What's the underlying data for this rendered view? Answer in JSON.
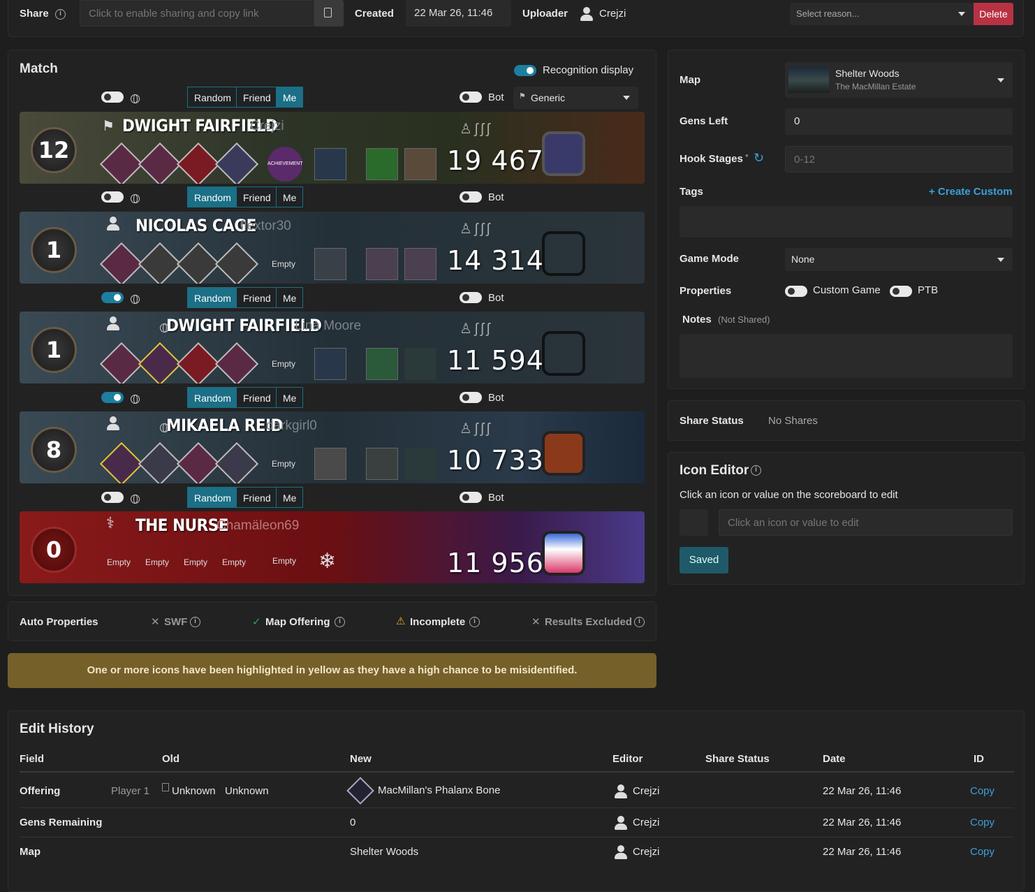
{
  "topbar": {
    "share_label": "Share",
    "share_placeholder": "Click to enable sharing and copy link",
    "created_label": "Created",
    "created_value": "22 Mar 26, 11:46",
    "uploader_label": "Uploader",
    "uploader_name": "Crejzi",
    "reason_placeholder": "Select reason...",
    "delete_label": "Delete"
  },
  "match": {
    "title": "Match",
    "recognition_label": "Recognition display",
    "killer_select": "Generic",
    "bot_label": "Bot",
    "btn_random": "Random",
    "btn_friend": "Friend",
    "btn_me": "Me",
    "empty_label": "Empty"
  },
  "players": [
    {
      "pips": "12",
      "name": "DWIGHT FAIRFIELD",
      "user": "Crejzi",
      "score": "19 467",
      "active": "Me",
      "toggle_on": false
    },
    {
      "pips": "1",
      "name": "NICOLAS CAGE",
      "user": "flextor30",
      "score": "14 314",
      "active": "Random",
      "toggle_on": false
    },
    {
      "pips": "1",
      "name": "DWIGHT FAIRFIELD",
      "user": "Lina Moore",
      "score": "11 594",
      "active": "Random",
      "toggle_on": true
    },
    {
      "pips": "8",
      "name": "MIKAELA REID",
      "user": "darkgirl0",
      "score": "10 733",
      "active": "Random",
      "toggle_on": true
    },
    {
      "pips": "0",
      "name": "THE NURSE",
      "user": "Chamäleon69",
      "score": "11 956",
      "active": "Random",
      "toggle_on": false
    }
  ],
  "achievement_label": "ACHIEVEMENT",
  "auto": {
    "title": "Auto Properties",
    "swf": "SWF",
    "map_offering": "Map Offering",
    "incomplete": "Incomplete",
    "results_excluded": "Results Excluded"
  },
  "warning": "One or more icons have been highlighted in yellow as they have a high chance to be misidentified.",
  "side": {
    "map_label": "Map",
    "map_name": "Shelter Woods",
    "map_realm": "The MacMillan Estate",
    "gens_label": "Gens Left",
    "gens_value": "0",
    "hooks_label": "Hook Stages",
    "hooks_star": "*",
    "hooks_placeholder": "0-12",
    "tags_label": "Tags",
    "create_custom": "+ Create Custom",
    "mode_label": "Game Mode",
    "mode_value": "None",
    "props_label": "Properties",
    "custom_game": "Custom Game",
    "ptb": "PTB",
    "notes_label": "Notes",
    "notes_sub": "(Not Shared)"
  },
  "share_status": {
    "label": "Share Status",
    "value": "No Shares"
  },
  "icon_editor": {
    "title": "Icon Editor",
    "desc": "Click an icon or value on the scoreboard to edit",
    "placeholder": "Click an icon or value to edit",
    "saved": "Saved"
  },
  "history": {
    "title": "Edit History",
    "headers": [
      "Field",
      "Old",
      "New",
      "Editor",
      "Share Status",
      "Date",
      "ID"
    ],
    "rows": [
      {
        "field": "Offering",
        "old_player": "Player 1",
        "old_img": "Unknown",
        "old": "Unknown",
        "new": "MacMillan's Phalanx Bone",
        "editor": "Crejzi",
        "date": "22 Mar 26, 11:46",
        "id": "Copy"
      },
      {
        "field": "Gens Remaining",
        "old_player": "",
        "old_img": "",
        "old": "",
        "new": "0",
        "editor": "Crejzi",
        "date": "22 Mar 26, 11:46",
        "id": "Copy"
      },
      {
        "field": "Map",
        "old_player": "",
        "old_img": "",
        "old": "",
        "new": "Shelter Woods",
        "editor": "Crejzi",
        "date": "22 Mar 26, 11:46",
        "id": "Copy"
      }
    ]
  }
}
